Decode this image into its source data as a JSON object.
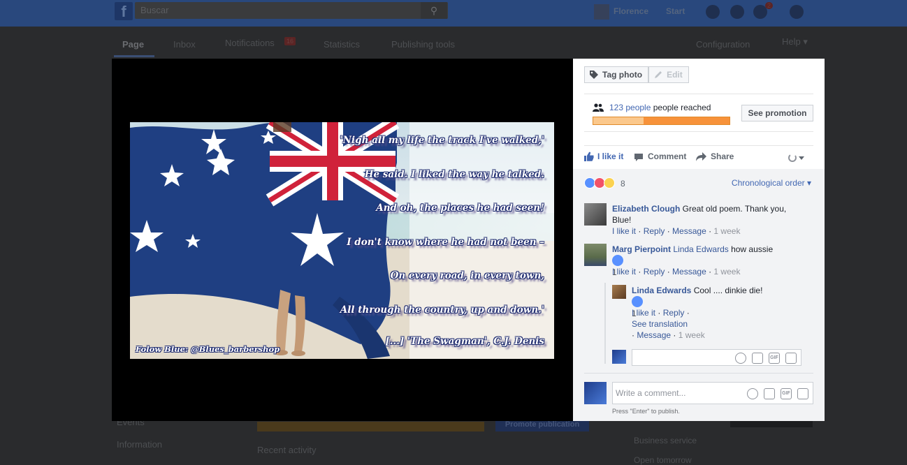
{
  "topbar": {
    "logo": "f",
    "search_placeholder": "Buscar",
    "user_name": "Florence",
    "start": "Start",
    "notif_count": "2"
  },
  "subnav": {
    "tabs": [
      "Page",
      "Inbox",
      "Notifications",
      "Statistics",
      "Publishing tools"
    ],
    "notif_badge": "16",
    "configuration": "Configuration",
    "help": "Help ▾"
  },
  "background": {
    "left_items": [
      "Events",
      "Information"
    ],
    "recent_activity": "Recent activity",
    "promote_button": "Promote publication",
    "business_service": "Business service",
    "open_tomorrow": "Open tomorrow"
  },
  "photo": {
    "poem_lines": [
      "'Nigh all my life the track I've walked,'",
      "He said. I liked the way he talked.",
      "And oh, the places he had seen!",
      "I don't know where he had not been –",
      "On every road, in every town,",
      "All through the country, up and down.'"
    ],
    "attribution": "[...] 'The Swagman', C.J. Denis",
    "follow": "Folow Blue: @Blues_barbershop"
  },
  "panel": {
    "tag_photo": "Tag photo",
    "edit": "Edit",
    "reach_count": "123 people",
    "reach_suffix": " people reached",
    "reach_fraction": 0.37,
    "see_promotion": "See promotion",
    "actions": {
      "like": "I like it",
      "comment": "Comment",
      "share": "Share"
    },
    "reactions_count": "8",
    "order": "Chronological order ▾",
    "comments": [
      {
        "name": "Elizabeth Clough",
        "text": " Great old poem. Thank you, Blue!",
        "like": "I like it",
        "reply": "Reply",
        "message": "Message",
        "time": "1 week"
      },
      {
        "name": "Marg Pierpoint",
        "mention": "Linda Edwards",
        "text": " how aussie",
        "likes": "1",
        "like": "I like it",
        "reply": "Reply",
        "message": "Message",
        "time": "1 week"
      }
    ],
    "reply": {
      "name": "Linda Edwards",
      "text": " Cool .... dinkie die!",
      "likes": "1",
      "like": "I like it",
      "reply": "Reply",
      "see_translation": "See translation",
      "message": "Message",
      "time": "1 week"
    },
    "write_comment_placeholder": "Write a comment...",
    "publish_hint": "Press \"Enter\" to publish.",
    "colors": {
      "link": "#385898",
      "accent": "#4267b2",
      "reach_bar": "#f7923a"
    }
  }
}
